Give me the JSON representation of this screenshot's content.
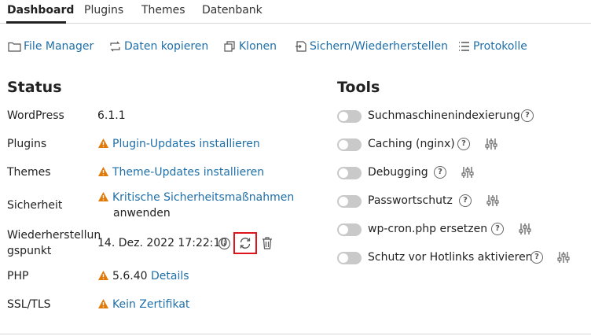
{
  "tabs": [
    {
      "label": "Dashboard",
      "active": true
    },
    {
      "label": "Plugins",
      "active": false
    },
    {
      "label": "Themes",
      "active": false
    },
    {
      "label": "Datenbank",
      "active": false
    }
  ],
  "toolbar": {
    "file_manager": "File Manager",
    "copy_data": "Daten kopieren",
    "clone": "Klonen",
    "backup_restore": "Sichern/Wiederherstellen",
    "logs": "Protokolle"
  },
  "status": {
    "title": "Status",
    "wordpress": {
      "label": "WordPress",
      "value": "6.1.1"
    },
    "plugins": {
      "label": "Plugins",
      "value": "Plugin-Updates installieren"
    },
    "themes": {
      "label": "Themes",
      "value": "Theme-Updates installieren"
    },
    "security": {
      "label": "Sicherheit",
      "value_line1": "Kritische Sicherheitsmaßnahmen",
      "value_line2": "anwenden"
    },
    "restore_point": {
      "label_line1": "Wiederherstellun",
      "label_line2": "gspunkt",
      "value": "14. Dez. 2022 17:22:10"
    },
    "php": {
      "label": "PHP",
      "value": "5.6.40",
      "link": "Details"
    },
    "ssl": {
      "label": "SSL/TLS",
      "value": "Kein Zertifikat"
    }
  },
  "tools": {
    "title": "Tools",
    "items": [
      {
        "label": "Suchmaschinenindexierung",
        "enabled": false,
        "has_settings": false
      },
      {
        "label": "Caching (nginx)",
        "enabled": false,
        "has_settings": true
      },
      {
        "label": "Debugging",
        "enabled": false,
        "has_settings": true
      },
      {
        "label": "Passwortschutz",
        "enabled": false,
        "has_settings": true
      },
      {
        "label": "wp-cron.php ersetzen",
        "enabled": false,
        "has_settings": true
      },
      {
        "label": "Schutz vor Hotlinks aktivieren",
        "enabled": false,
        "has_settings": true
      }
    ],
    "help_glyph": "?"
  },
  "colors": {
    "link": "#1f6fa8",
    "warning": "#e07b0a",
    "highlight": "#e0141c",
    "toggle_off": "#c9c9c9"
  },
  "icons": {
    "file_manager": "folder-icon",
    "copy_data": "sync-arrows-icon",
    "clone": "copy-icon",
    "backup_restore": "backup-restore-icon",
    "logs": "list-icon",
    "warning": "warning-triangle-icon",
    "info": "info-circle-icon",
    "sync": "sync-icon",
    "delete": "trash-icon",
    "settings": "sliders-icon"
  }
}
